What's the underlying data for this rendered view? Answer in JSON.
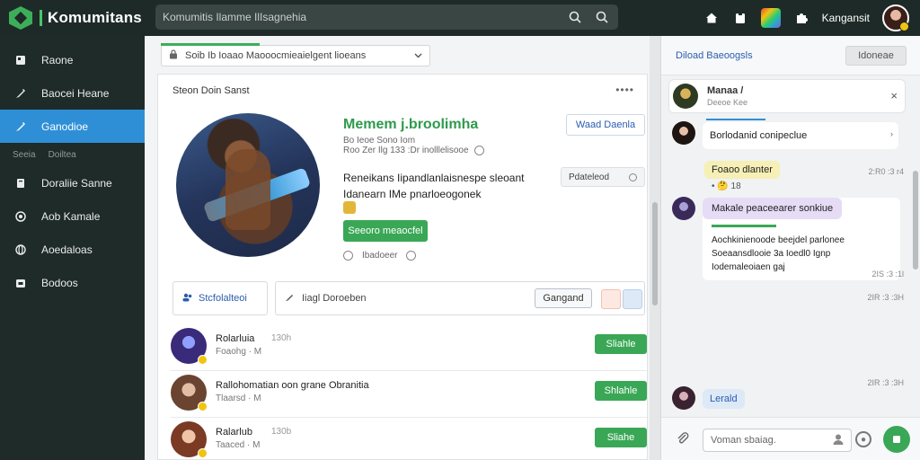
{
  "header": {
    "brand": "Komumitans",
    "search_placeholder": "Komumitis Ilamme IlIsagnehia",
    "username": "Kangansit",
    "icons": [
      "search-icon",
      "magnifier-icon",
      "home-icon",
      "clipboard-icon",
      "apps-icon",
      "puzzle-icon"
    ]
  },
  "sidebar": {
    "items": [
      {
        "label": "Raone",
        "icon": "id-card-icon"
      },
      {
        "label": "Baocei Heane",
        "icon": "pen-icon"
      },
      {
        "label": "Ganodioe",
        "icon": "pencil-icon",
        "active": true
      }
    ],
    "section": {
      "left": "Seeia",
      "right": "Doiltea"
    },
    "items2": [
      {
        "label": "Doraliie Sanne",
        "icon": "document-icon"
      },
      {
        "label": "Aob Kamale",
        "icon": "settings-circle-icon"
      },
      {
        "label": "Aoedaloas",
        "icon": "globe-icon"
      },
      {
        "label": "Bodoos",
        "icon": "folder-icon"
      }
    ]
  },
  "main": {
    "select_text": "Soib Ib Ioaao Maooocmieaielgent lioeans",
    "card_title": "Steon Doin Sanst",
    "profile": {
      "name": "Memem j.broolimha",
      "meta": "Bo Ieoe Sono Iom",
      "meta2": "Roo Zer Ilg 133 :Dr inolllelisooe",
      "desc_line1": "Reneikans Iipandlanlaisnespe sleoant",
      "desc_line2": "Idanearn IMe pnarloeogonek",
      "primary_button": "Seeoro meaocfel",
      "footer": "Ibadoeer",
      "outline_button": "Waad Daenla",
      "pill_button": "Pdateleod"
    },
    "tabs": {
      "left": "Stcfolalteoi",
      "search": "Iiagl Doroeben",
      "search_button": "Gangand"
    },
    "list": [
      {
        "name": "Rolarluia",
        "num": "130h",
        "sub": "Foaohg · M",
        "button": "Sliahle",
        "color": "#5a3aa8"
      },
      {
        "name": "Rallohomatian oon grane Obranitia",
        "num": "",
        "sub": "Tlaarsd · M",
        "button": "Shlahle",
        "color": "#7a5238"
      },
      {
        "name": "Ralarlub",
        "num": "130b",
        "sub": "Taaced · M",
        "button": "Sliahe",
        "color": "#8a4a32"
      }
    ]
  },
  "chat": {
    "title": "Diload Baeoogsls",
    "header_button": "Idoneae",
    "pinned": {
      "name": "Manaa /",
      "sub": "Deeoe Kee"
    },
    "messages": [
      {
        "text": "Borlodanid conipeclue",
        "chip": "Foaoo dlanter",
        "ts": "2:R0 :3 r4",
        "reactions": "• 🤔 18"
      },
      {
        "text": "Makale peaceearer sonkiue",
        "line2": "Aochkinienoode beejdel parlonee",
        "line3": "Soeaansdlooie 3a Ioedl0 Ignp",
        "line4": "Iodemaleoiaen gaj",
        "ts": "2IS :3 :1l"
      },
      {
        "text": "",
        "ts": "2IR :3 :3H"
      },
      {
        "chip": "Lerald",
        "ts": ""
      }
    ],
    "input_placeholder": "Voman sbaiag."
  }
}
